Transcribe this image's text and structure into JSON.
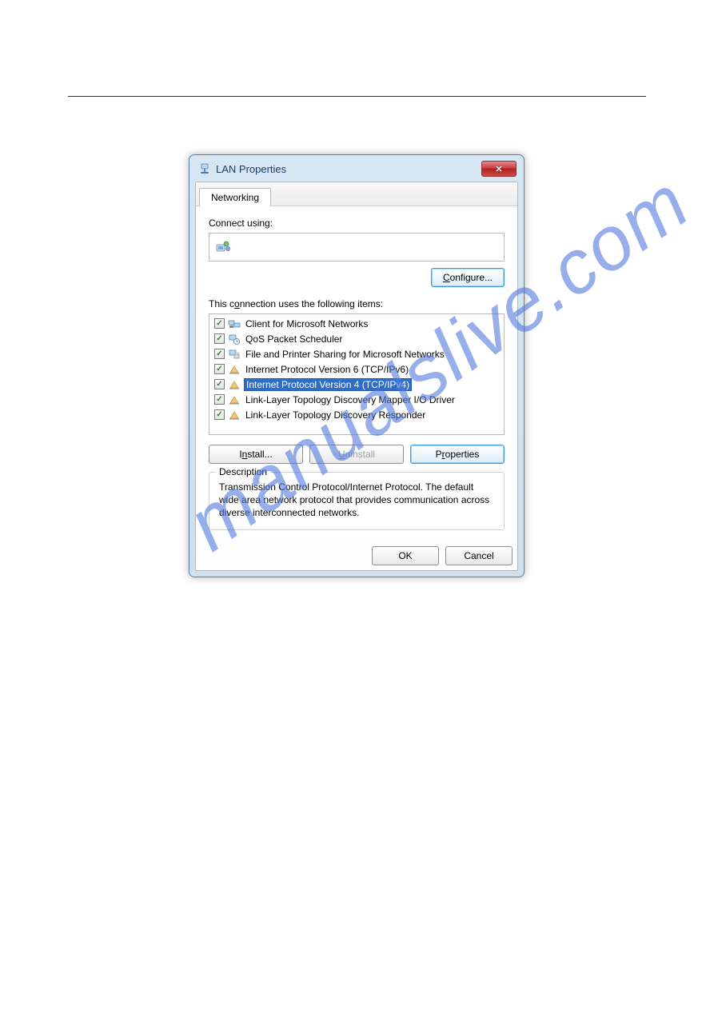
{
  "dialog": {
    "title": "LAN Properties",
    "tabs": {
      "networking": "Networking"
    },
    "connect_label": "Connect using:",
    "configure_label": "Configure...",
    "items_label": "This connection uses the following items:",
    "items": [
      {
        "icon": "client-icon",
        "label": "Client for Microsoft Networks",
        "checked": true,
        "selected": false
      },
      {
        "icon": "qos-icon",
        "label": "QoS Packet Scheduler",
        "checked": true,
        "selected": false
      },
      {
        "icon": "fileprint-icon",
        "label": "File and Printer Sharing for Microsoft Networks",
        "checked": true,
        "selected": false
      },
      {
        "icon": "protocol-icon",
        "label": "Internet Protocol Version 6 (TCP/IPv6)",
        "checked": true,
        "selected": false
      },
      {
        "icon": "protocol-icon",
        "label": "Internet Protocol Version 4 (TCP/IPv4)",
        "checked": true,
        "selected": true
      },
      {
        "icon": "protocol-icon",
        "label": "Link-Layer Topology Discovery Mapper I/O Driver",
        "checked": true,
        "selected": false
      },
      {
        "icon": "protocol-icon",
        "label": "Link-Layer Topology Discovery Responder",
        "checked": true,
        "selected": false
      }
    ],
    "buttons": {
      "install": "Install...",
      "uninstall": "Uninstall",
      "properties": "Properties",
      "ok": "OK",
      "cancel": "Cancel"
    },
    "description_legend": "Description",
    "description_text": "Transmission Control Protocol/Internet Protocol. The default wide area network protocol that provides communication across diverse interconnected networks."
  },
  "watermark": "manualslive.com"
}
